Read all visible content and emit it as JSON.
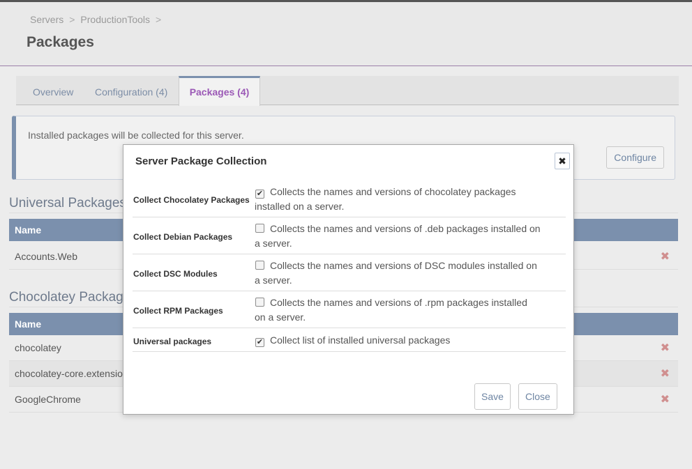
{
  "breadcrumb": [
    "Servers",
    "ProductionTools"
  ],
  "breadcrumb_sep": ">",
  "page_title": "Packages",
  "tabs": [
    {
      "label": "Overview"
    },
    {
      "label": "Configuration (4)"
    },
    {
      "label": "Packages (4)",
      "active": true
    }
  ],
  "info": {
    "text": "Installed packages will be collected for this server.",
    "configure_label": "Configure"
  },
  "universal": {
    "title": "Universal Packages",
    "column": "Name",
    "rows": [
      "Accounts.Web"
    ]
  },
  "chocolatey": {
    "title": "Chocolatey Packages",
    "column": "Name",
    "rows": [
      "chocolatey",
      "chocolatey-core.extension",
      "GoogleChrome"
    ]
  },
  "modal": {
    "title": "Server Package Collection",
    "close_icon": "close-icon",
    "options": [
      {
        "label": "Collect Chocolatey Packages",
        "checked": true,
        "desc": "Collects the names and versions of chocolatey packages installed on a server."
      },
      {
        "label": "Collect Debian Packages",
        "checked": false,
        "desc": "Collects the names and versions of .deb packages installed on a server."
      },
      {
        "label": "Collect DSC Modules",
        "checked": false,
        "desc": "Collects the names and versions of DSC modules installed on a server."
      },
      {
        "label": "Collect RPM Packages",
        "checked": false,
        "desc": "Collects the names and versions of .rpm packages installed on a server."
      },
      {
        "label": "Universal packages",
        "checked": true,
        "desc": "Collect list of installed universal packages"
      }
    ],
    "save_label": "Save",
    "close_label": "Close"
  },
  "colors": {
    "accent": "#7b90ad",
    "active_tab": "#9b59b6",
    "delete": "#d08f8f"
  }
}
